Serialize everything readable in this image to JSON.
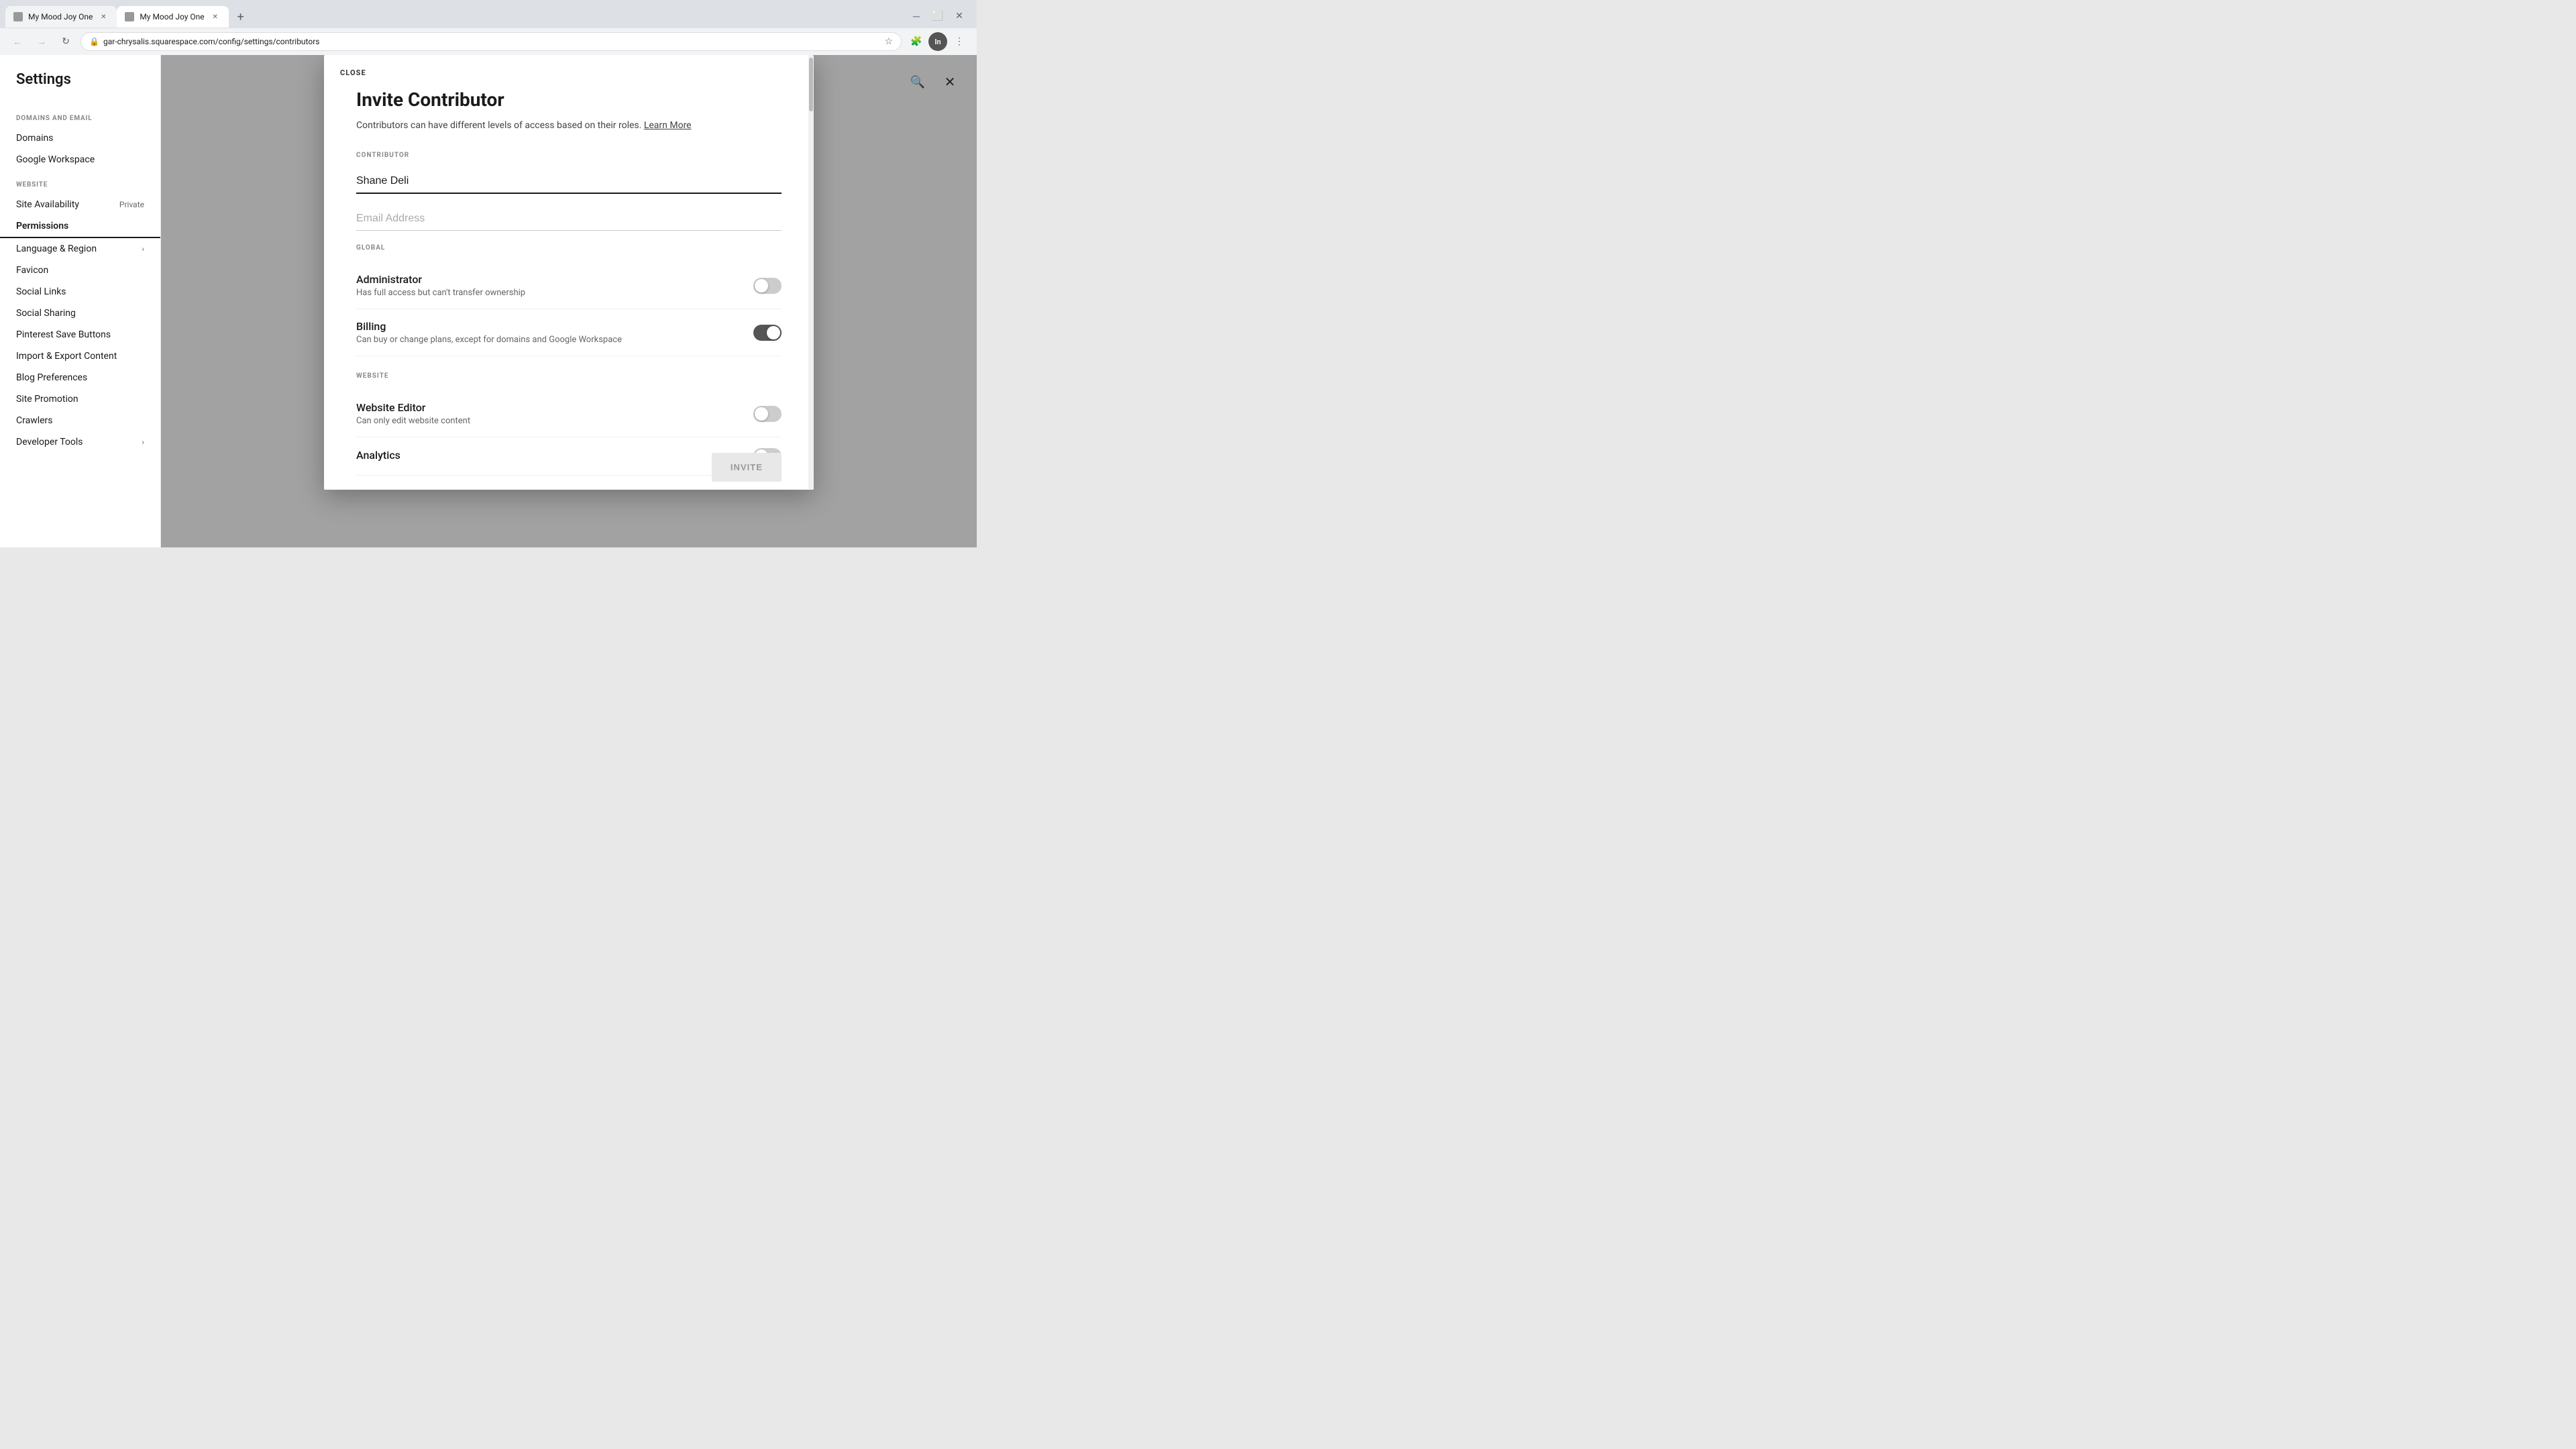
{
  "browser": {
    "tabs": [
      {
        "id": "tab1",
        "title": "My Mood Joy One",
        "favicon": "🌐",
        "active": false
      },
      {
        "id": "tab2",
        "title": "My Mood Joy One",
        "favicon": "🌐",
        "active": true
      }
    ],
    "new_tab_label": "+",
    "back_btn": "←",
    "forward_btn": "→",
    "reload_btn": "↻",
    "address": "gar-chrysalis.squarespace.com/config/settings/contributors",
    "star_icon": "☆",
    "extensions_icon": "🧩",
    "profile_label": "Incognito",
    "menu_icon": "⋮",
    "window_minimize": "─",
    "window_maximize": "⬜",
    "window_close": "✕"
  },
  "sidebar": {
    "title": "Settings",
    "sections": [
      {
        "label": "Domains and Email",
        "items": [
          {
            "id": "domains",
            "label": "Domains",
            "badge": null,
            "arrow": false
          },
          {
            "id": "google-workspace",
            "label": "Google Workspace",
            "badge": null,
            "arrow": false
          }
        ]
      },
      {
        "label": "Website",
        "items": [
          {
            "id": "site-availability",
            "label": "Site Availability",
            "badge": "Private",
            "arrow": false
          },
          {
            "id": "permissions",
            "label": "Permissions",
            "badge": null,
            "arrow": false,
            "active": true
          },
          {
            "id": "language-region",
            "label": "Language & Region",
            "badge": null,
            "arrow": true
          },
          {
            "id": "favicon",
            "label": "Favicon",
            "badge": null,
            "arrow": false
          },
          {
            "id": "social-links",
            "label": "Social Links",
            "badge": null,
            "arrow": false
          },
          {
            "id": "social-sharing",
            "label": "Social Sharing",
            "badge": null,
            "arrow": false
          },
          {
            "id": "pinterest-save-buttons",
            "label": "Pinterest Save Buttons",
            "badge": null,
            "arrow": false
          },
          {
            "id": "import-export-content",
            "label": "Import & Export Content",
            "badge": null,
            "arrow": false
          },
          {
            "id": "blog-preferences",
            "label": "Blog Preferences",
            "badge": null,
            "arrow": false
          },
          {
            "id": "site-promotion",
            "label": "Site Promotion",
            "badge": null,
            "arrow": false
          },
          {
            "id": "crawlers",
            "label": "Crawlers",
            "badge": null,
            "arrow": false
          },
          {
            "id": "developer-tools",
            "label": "Developer Tools",
            "badge": null,
            "arrow": true
          }
        ]
      }
    ]
  },
  "header": {
    "search_icon": "🔍",
    "close_icon": "✕"
  },
  "modal": {
    "close_label": "CLOSE",
    "title": "Invite Contributor",
    "description_text": "Contributors can have different levels of access based on their roles.",
    "learn_more_label": "Learn More",
    "contributor_section_label": "CONTRIBUTOR",
    "name_placeholder": "Shane Deli",
    "email_placeholder": "Email Address",
    "global_section_label": "GLOBAL",
    "roles": [
      {
        "id": "administrator",
        "label": "Administrator",
        "description": "Has full access but can't transfer ownership",
        "enabled": false
      },
      {
        "id": "billing",
        "label": "Billing",
        "description": "Can buy or change plans, except for domains and Google Workspace",
        "enabled": true
      }
    ],
    "website_section_label": "WEBSITE",
    "website_roles": [
      {
        "id": "website-editor",
        "label": "Website Editor",
        "description": "Can only edit website content",
        "enabled": false
      },
      {
        "id": "analytics",
        "label": "Analytics",
        "description": "",
        "enabled": false
      }
    ],
    "invite_btn_label": "INVITE"
  }
}
